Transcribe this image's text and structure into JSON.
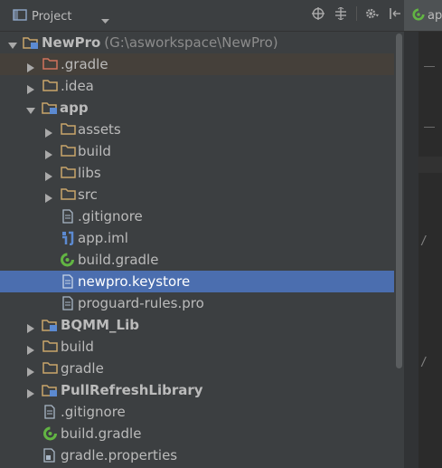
{
  "toolbar": {
    "view_title": "Project",
    "icons": [
      "project-view-icon",
      "dropdown-arrow-icon",
      "scroll-from-source-icon",
      "collapse-all-icon",
      "gear-icon",
      "hide-icon"
    ]
  },
  "editor": {
    "tab_label": "ap",
    "tab_icon": "gradle-file-icon",
    "code_fragments": [
      "/",
      "/"
    ]
  },
  "tree": [
    {
      "label": "NewPro",
      "hint": "(G:\\asworkspace\\NewPro)",
      "icon": "module-folder-icon",
      "expanded": true
    },
    {
      "label": ".gradle",
      "icon": "folder-icon",
      "expanded": false
    },
    {
      "label": ".idea",
      "icon": "folder-icon",
      "expanded": false
    },
    {
      "label": "app",
      "icon": "module-folder-icon",
      "expanded": true
    },
    {
      "label": "assets",
      "icon": "folder-icon",
      "expanded": false
    },
    {
      "label": "build",
      "icon": "folder-icon",
      "expanded": false
    },
    {
      "label": "libs",
      "icon": "folder-icon",
      "expanded": false
    },
    {
      "label": "src",
      "icon": "folder-icon",
      "expanded": false
    },
    {
      "label": ".gitignore",
      "icon": "text-file-icon"
    },
    {
      "label": "app.iml",
      "icon": "iml-file-icon"
    },
    {
      "label": "build.gradle",
      "icon": "gradle-file-icon"
    },
    {
      "label": "newpro.keystore",
      "icon": "text-file-icon",
      "selected": true
    },
    {
      "label": "proguard-rules.pro",
      "icon": "text-file-icon"
    },
    {
      "label": "BQMM_Lib",
      "icon": "module-folder-icon",
      "expanded": false
    },
    {
      "label": "build",
      "icon": "folder-icon",
      "expanded": false
    },
    {
      "label": "gradle",
      "icon": "folder-icon",
      "expanded": false
    },
    {
      "label": "PullRefreshLibrary",
      "icon": "module-folder-icon",
      "expanded": false
    },
    {
      "label": ".gitignore",
      "icon": "text-file-icon"
    },
    {
      "label": "build.gradle",
      "icon": "gradle-file-icon"
    },
    {
      "label": "gradle.properties",
      "icon": "properties-file-icon"
    }
  ],
  "colors": {
    "background": "#3c3f41",
    "selection": "#4b6eaf",
    "hover_row": "#45403a",
    "folder": "#c9a56a",
    "gradle_green": "#62b543"
  }
}
